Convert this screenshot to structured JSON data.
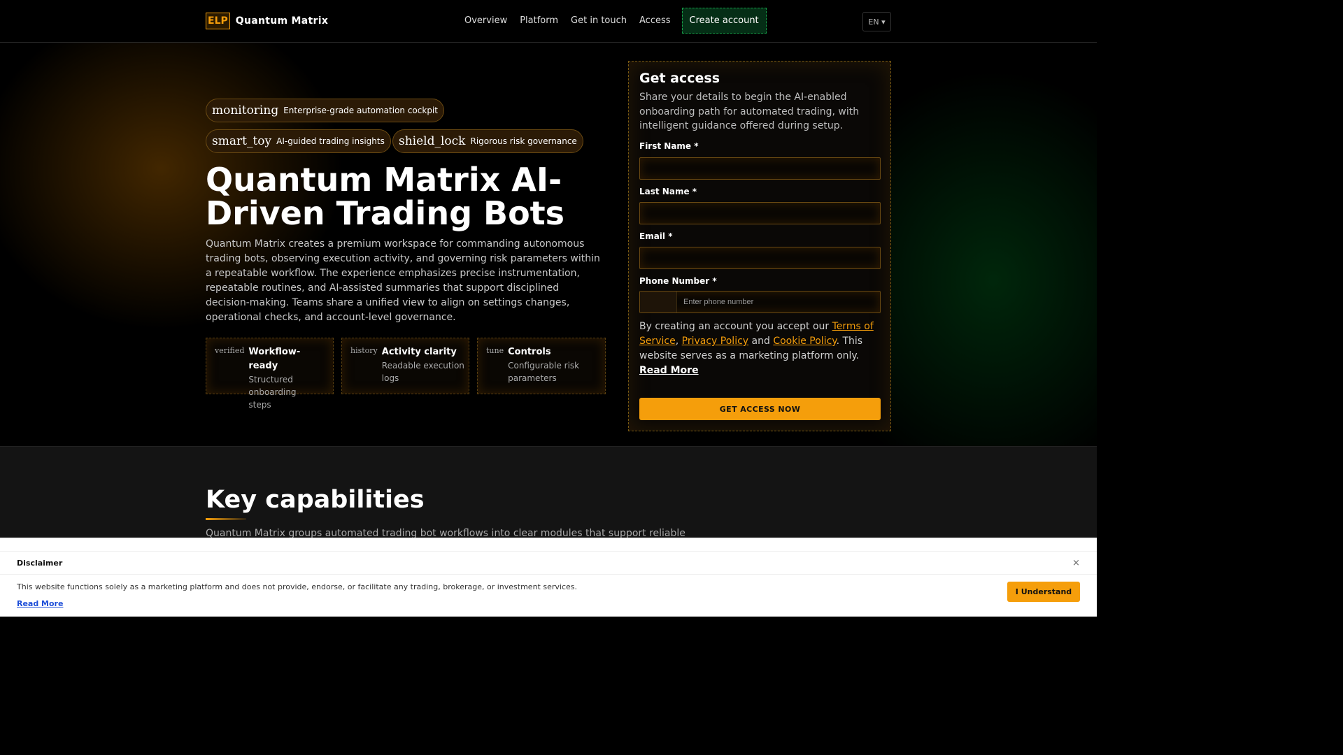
{
  "header": {
    "logo_mark": "ELP",
    "brand": "Quantum Matrix",
    "nav": [
      "Overview",
      "Platform",
      "Get in touch",
      "Access"
    ],
    "cta": "Create account",
    "lang": "EN ▾"
  },
  "hero": {
    "chips": [
      {
        "icon": "monitoring",
        "text": "Enterprise-grade automation cockpit"
      },
      {
        "icon": "smart_toy",
        "text": "AI-guided trading insights"
      },
      {
        "icon": "shield_lock",
        "text": "Rigorous risk governance"
      }
    ],
    "title": "Quantum Matrix AI-Driven Trading Bots",
    "description": "Quantum Matrix creates a premium workspace for commanding autonomous trading bots, observing execution activity, and governing risk parameters within a repeatable workflow. The experience emphasizes precise instrumentation, repeatable routines, and AI-assisted summaries that support disciplined decision-making. Teams share a unified view to align on settings changes, operational checks, and account-level governance.",
    "features": [
      {
        "icon": "verified",
        "title": "Workflow-ready",
        "subtitle": "Structured onboarding steps"
      },
      {
        "icon": "history",
        "title": "Activity clarity",
        "subtitle": "Readable execution logs"
      },
      {
        "icon": "tune",
        "title": "Controls",
        "subtitle": "Configurable risk parameters"
      }
    ]
  },
  "form": {
    "title": "Get access",
    "description": "Share your details to begin the AI-enabled onboarding path for automated trading, with intelligent guidance offered during setup.",
    "first_name_label": "First Name *",
    "last_name_label": "Last Name *",
    "email_label": "Email *",
    "phone_label": "Phone Number *",
    "phone_placeholder": "Enter phone number",
    "terms_prefix": "By creating an account you accept our ",
    "terms_link": "Terms of Service",
    "comma": ", ",
    "privacy_link": "Privacy Policy",
    "and": " and ",
    "cookie_link": "Cookie Policy",
    "terms_suffix": ". This website serves as a marketing platform only. ",
    "read_more": "Read More",
    "submit": "GET ACCESS NOW"
  },
  "capabilities": {
    "title": "Key capabilities",
    "description": "Quantum Matrix groups automated trading bot workflows into clear modules that support reliable"
  },
  "disclaimer": {
    "title": "Disclaimer",
    "close": "×",
    "text": "This website functions solely as a marketing platform and does not provide, endorse, or facilitate any trading, brokerage, or investment services.",
    "read_more": "Read More",
    "button": "I Understand"
  },
  "colors": {
    "accent": "#f59e0b",
    "cta_green": "#16a34a",
    "background": "#000000"
  }
}
